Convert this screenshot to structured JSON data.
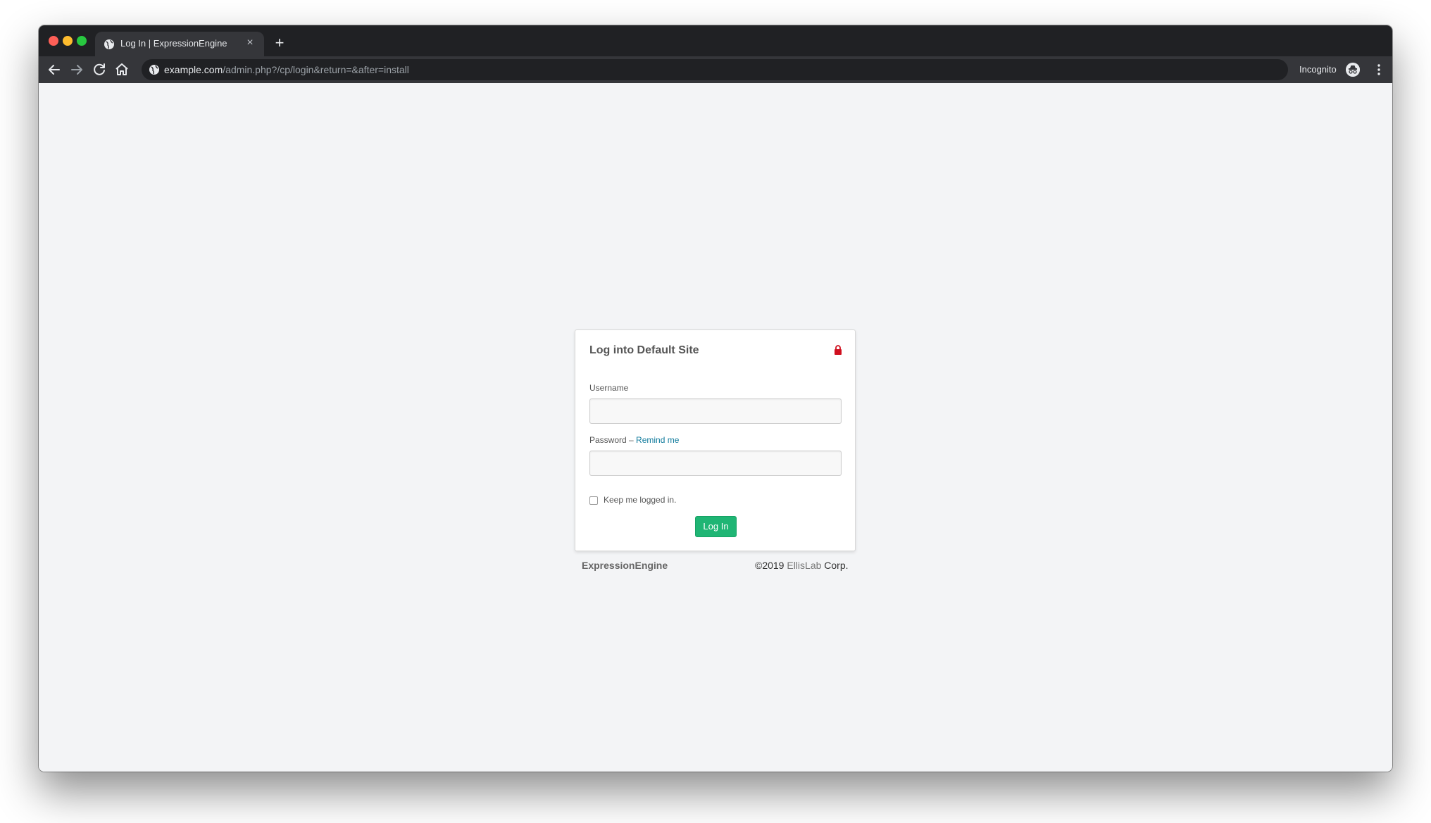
{
  "browser": {
    "tab_title": "Log In | ExpressionEngine",
    "tab_close": "×",
    "new_tab": "+",
    "url_host": "example.com",
    "url_path": "/admin.php?/cp/login&return=&after=install",
    "incognito_label": "Incognito"
  },
  "login": {
    "title": "Log into Default Site",
    "username_label": "Username",
    "username_value": "",
    "password_label": "Password –",
    "remind_link": "Remind me",
    "password_value": "",
    "remember_label": "Keep me logged in.",
    "remember_checked": false,
    "submit_label": "Log In"
  },
  "footer": {
    "brand": "ExpressionEngine",
    "copyright_prefix": "©2019",
    "company_link": "EllisLab",
    "copyright_suffix": "Corp."
  },
  "colors": {
    "accent_green": "#1fb574",
    "link": "#0f7a9c",
    "lock_red": "#d0101f",
    "page_bg": "#f3f4f6"
  },
  "icons": [
    "globe-icon",
    "back-arrow-icon",
    "forward-arrow-icon",
    "reload-icon",
    "home-icon",
    "site-info-icon",
    "incognito-icon",
    "more-menu-icon",
    "lock-icon"
  ]
}
